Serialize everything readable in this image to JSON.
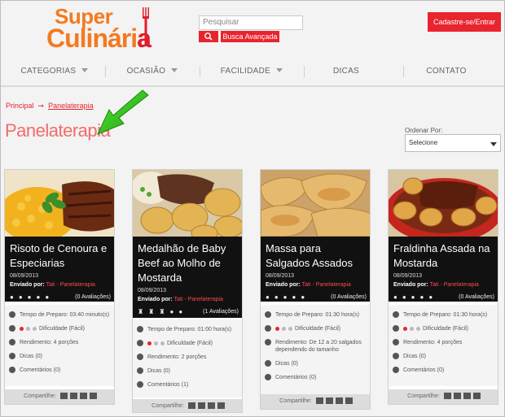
{
  "header": {
    "logo_line1": "Super",
    "logo_line2_a": "Culinári",
    "logo_line2_b": "a",
    "search_placeholder": "Pesquisar",
    "advanced_search": "Busca Avançada",
    "register": "Cadastre-se/Entrar"
  },
  "nav": {
    "items": [
      "CATEGORIAS",
      "OCASIÃO",
      "FACILIDADE",
      "DICAS",
      "CONTATO"
    ]
  },
  "breadcrumb": {
    "home": "Principal",
    "current": "Panelaterapia"
  },
  "page_title": "Panelaterapia",
  "order": {
    "label": "Ordenar Por:",
    "selected": "Selecione"
  },
  "colors": {
    "accent": "#e8242e",
    "brand_orange": "#f47a20",
    "annotation_arrow": "#33c41a"
  },
  "cards": [
    {
      "title_l1": "Risoto de Cenoura e",
      "title_l2": "Especiarias",
      "title_l3": "",
      "date": "08/09/2013",
      "sent_by": "Enviado por:",
      "author": "Tati - Panelaterapia",
      "ratings": "(0 Avaliações)",
      "prep": "Tempo de Preparo: 03:40 minuto(s)",
      "difficulty": "Dificuldade (Fácil)",
      "yield": "Rendimento: 4 porções",
      "yield_l2": "",
      "tips": "Dicas (0)",
      "comments": "Comentários (0)",
      "share": "Compartilhe:"
    },
    {
      "title_l1": "Medalhão de Baby",
      "title_l2": "Beef ao Molho de",
      "title_l3": "Mostarda",
      "date": "08/09/2013",
      "sent_by": "Enviado por:",
      "author": "Tati - Panelaterapia",
      "ratings": "(1 Avaliações)",
      "prep": "Tempo de Preparo: 01:00 hora(s)",
      "difficulty": "Dificuldade (Fácil)",
      "yield": "Rendimento: 2 porções",
      "yield_l2": "",
      "tips": "Dicas (0)",
      "comments": "Comentários (1)",
      "share": "Compartilhe:"
    },
    {
      "title_l1": "Massa para",
      "title_l2": "Salgados Assados",
      "title_l3": "",
      "date": "08/09/2013",
      "sent_by": "Enviado por:",
      "author": "Tati - Panelaterapia",
      "ratings": "(0 Avaliações)",
      "prep": "Tempo de Preparo: 01:30 hora(s)",
      "difficulty": "Dificuldade (Fácil)",
      "yield": "Rendimento: De 12 a 20 salgados",
      "yield_l2": "dependendo do tamanho",
      "tips": "Dicas (0)",
      "comments": "Comentários (0)",
      "share": "Compartilhe:"
    },
    {
      "title_l1": "Fraldinha Assada na",
      "title_l2": "Mostarda",
      "title_l3": "",
      "date": "08/09/2013",
      "sent_by": "Enviado por:",
      "author": "Tati - Panelaterapia",
      "ratings": "(0 Avaliações)",
      "prep": "Tempo de Preparo: 01:30 hora(s)",
      "difficulty": "Dificuldade (Fácil)",
      "yield": "Rendimento: 4 porções",
      "yield_l2": "",
      "tips": "Dicas (0)",
      "comments": "Comentários (0)",
      "share": "Compartilhe:"
    }
  ]
}
